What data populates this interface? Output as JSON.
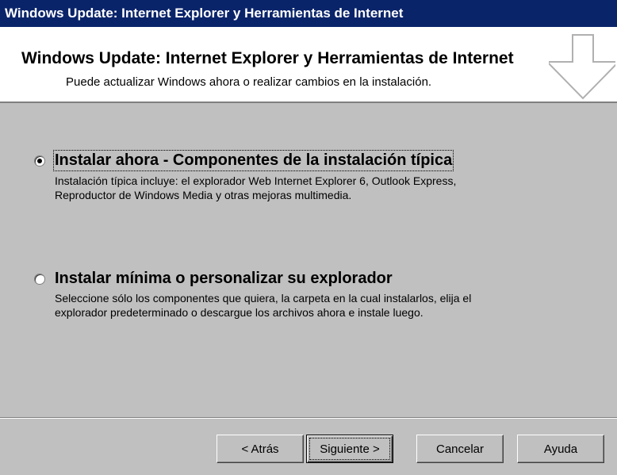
{
  "window": {
    "title": "Windows Update: Internet Explorer y Herramientas de Internet"
  },
  "header": {
    "title": "Windows Update: Internet Explorer y Herramientas de Internet",
    "subtitle": "Puede actualizar Windows ahora o realizar cambios en la instalación.",
    "icon": "down-arrow-icon"
  },
  "options": [
    {
      "label": "Instalar ahora - Componentes de la instalación típica",
      "selected": true,
      "desc_line1": "Instalación típica incluye: el explorador Web Internet Explorer 6, Outlook Express,",
      "desc_line2": "Reproductor de Windows Media y otras mejoras multimedia."
    },
    {
      "label": "Instalar mínima o personalizar su explorador",
      "selected": false,
      "desc_line1": "Seleccione sólo los componentes que quiera, la carpeta en la cual instalarlos, elija el",
      "desc_line2": "explorador predeterminado o descargue los archivos ahora e instale luego."
    }
  ],
  "buttons": {
    "back": "< Atrás",
    "next": "Siguiente >",
    "cancel": "Cancelar",
    "help": "Ayuda"
  },
  "colors": {
    "titlebar": "#0a246a",
    "dialog": "#c0c0c0",
    "header_bg": "#ffffff"
  }
}
